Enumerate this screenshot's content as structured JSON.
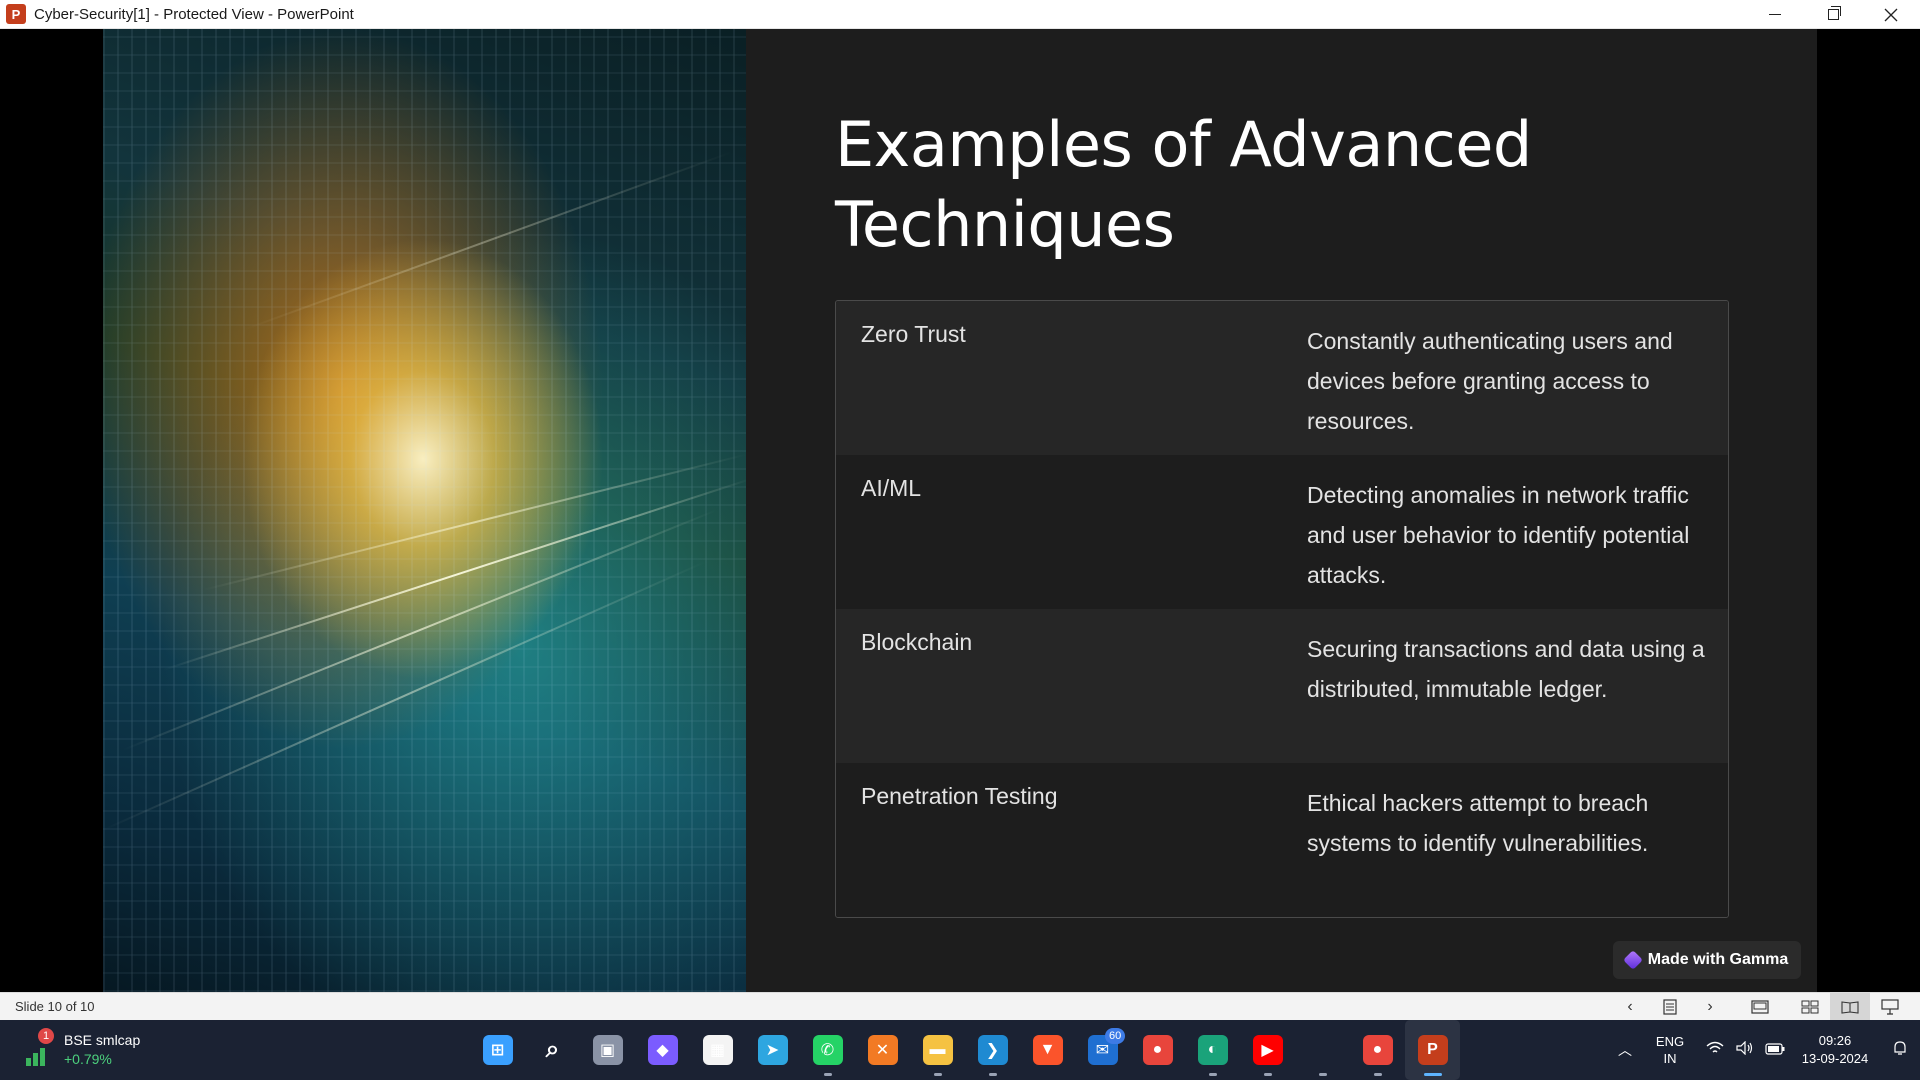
{
  "window": {
    "app_icon_letter": "P",
    "title": "Cyber-Security[1]  -  Protected View - PowerPoint"
  },
  "slide": {
    "title": "Examples of Advanced Techniques",
    "rows": [
      {
        "term": "Zero Trust",
        "description": "Constantly authenticating users and devices before granting access to resources."
      },
      {
        "term": "AI/ML",
        "description": "Detecting anomalies in network traffic and user behavior to identify potential attacks."
      },
      {
        "term": "Blockchain",
        "description": "Securing transactions and data using a distributed, immutable ledger."
      },
      {
        "term": "Penetration Testing",
        "description": "Ethical hackers attempt to breach systems to identify vulnerabilities."
      }
    ],
    "badge_label": "Made with Gamma"
  },
  "statusbar": {
    "slide_counter": "Slide 10 of 10"
  },
  "taskbar": {
    "widget": {
      "badge": "1",
      "title": "BSE smlcap",
      "value": "+0.79%"
    },
    "apps": [
      {
        "name": "start",
        "label": "⊞",
        "color": "#3aa0ff"
      },
      {
        "name": "search",
        "label": "⌕",
        "color": "transparent"
      },
      {
        "name": "task-view",
        "label": "▣",
        "color": "#8a93a6"
      },
      {
        "name": "copilot",
        "label": "◆",
        "color": "#7b5cff"
      },
      {
        "name": "microsoft-store",
        "label": "▦",
        "color": "#f4f4f4"
      },
      {
        "name": "telegram",
        "label": "➤",
        "color": "#2ea6e0"
      },
      {
        "name": "whatsapp",
        "label": "✆",
        "color": "#25d366"
      },
      {
        "name": "xampp",
        "label": "✕",
        "color": "#f27a24"
      },
      {
        "name": "file-explorer",
        "label": "▬",
        "color": "#f5c242"
      },
      {
        "name": "vscode",
        "label": "❯",
        "color": "#1f8ad2"
      },
      {
        "name": "brave",
        "label": "▼",
        "color": "#fb542b"
      },
      {
        "name": "outlook",
        "label": "✉",
        "color": "#1f6fd1"
      },
      {
        "name": "chrome",
        "label": "●",
        "color": "#e8453c"
      },
      {
        "name": "edge",
        "label": "◐",
        "color": "#1aa37a"
      },
      {
        "name": "youtube",
        "label": "▶",
        "color": "#ff0000"
      },
      {
        "name": "blank-app",
        "label": "",
        "color": "transparent"
      },
      {
        "name": "chrome-profile",
        "label": "●",
        "color": "#e8453c"
      },
      {
        "name": "powerpoint",
        "label": "P",
        "color": "#c43e1c"
      }
    ],
    "outlook_badge": "60",
    "lang_line1": "ENG",
    "lang_line2": "IN",
    "time": "09:26",
    "date": "13-09-2024"
  }
}
